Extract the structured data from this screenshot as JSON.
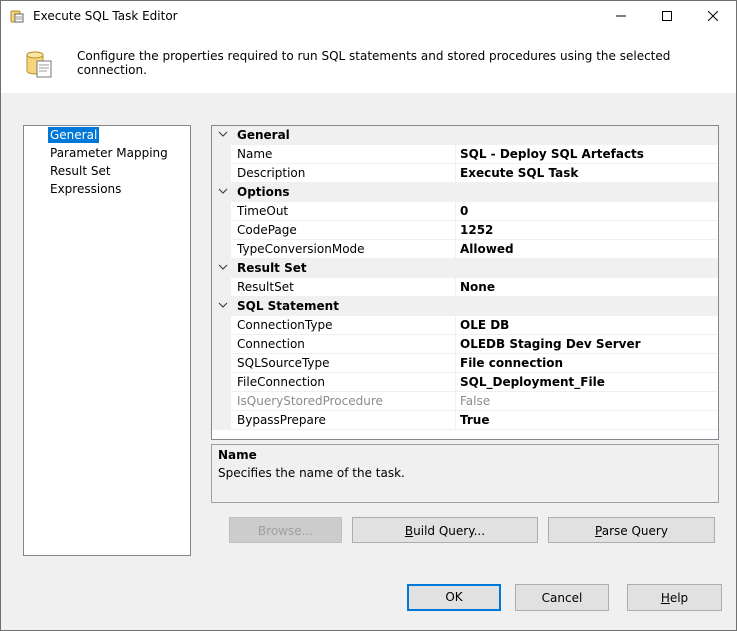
{
  "window": {
    "title": "Execute SQL Task Editor",
    "title_icon": "execute-sql-task-icon",
    "controls": {
      "minimize": "minimize-icon",
      "maximize": "maximize-icon",
      "close": "close-icon"
    }
  },
  "header": {
    "icon": "execute-sql-task-icon",
    "text": "Configure the properties required to run SQL statements and stored procedures using the selected connection."
  },
  "nav": {
    "items": [
      {
        "label": "General",
        "selected": true
      },
      {
        "label": "Parameter Mapping",
        "selected": false
      },
      {
        "label": "Result Set",
        "selected": false
      },
      {
        "label": "Expressions",
        "selected": false
      }
    ]
  },
  "properties": {
    "categories": [
      {
        "label": "General",
        "rows": [
          {
            "name": "Name",
            "value": "SQL - Deploy SQL Artefacts"
          },
          {
            "name": "Description",
            "value": "Execute SQL Task"
          }
        ]
      },
      {
        "label": "Options",
        "rows": [
          {
            "name": "TimeOut",
            "value": "0"
          },
          {
            "name": "CodePage",
            "value": "1252"
          },
          {
            "name": "TypeConversionMode",
            "value": "Allowed"
          }
        ]
      },
      {
        "label": "Result Set",
        "rows": [
          {
            "name": "ResultSet",
            "value": "None"
          }
        ]
      },
      {
        "label": "SQL Statement",
        "rows": [
          {
            "name": "ConnectionType",
            "value": "OLE DB"
          },
          {
            "name": "Connection",
            "value": "OLEDB Staging Dev Server"
          },
          {
            "name": "SQLSourceType",
            "value": "File connection"
          },
          {
            "name": "FileConnection",
            "value": "SQL_Deployment_File"
          },
          {
            "name": "IsQueryStoredProcedure",
            "value": "False",
            "disabled": true
          },
          {
            "name": "BypassPrepare",
            "value": "True"
          }
        ]
      }
    ]
  },
  "description_panel": {
    "title": "Name",
    "text": "Specifies the name of the task."
  },
  "buttons": {
    "browse": {
      "label": "Browse...",
      "disabled": true
    },
    "build_query": {
      "pre": "",
      "accel": "B",
      "post": "uild Query..."
    },
    "parse_query": {
      "pre": "",
      "accel": "P",
      "post": "arse Query"
    },
    "ok": "OK",
    "cancel": "Cancel",
    "help": {
      "pre": "",
      "accel": "H",
      "post": "elp"
    }
  },
  "colors": {
    "selection": "#0078d7",
    "window_bg": "#f0f0f0",
    "disabled_text": "#8c8c8c"
  }
}
